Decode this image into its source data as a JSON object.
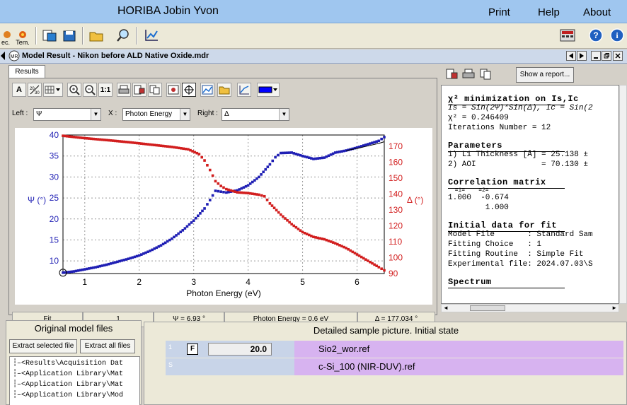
{
  "app": {
    "title": "HORIBA Jobin Yvon",
    "menu": [
      "Print",
      "Help",
      "About"
    ]
  },
  "toolbar": {
    "labels": [
      "ec.",
      "Tem."
    ]
  },
  "window": {
    "title": "Model Result - Nikon before ALD Native Oxide.mdr"
  },
  "tabs": [
    "Results"
  ],
  "plot_toolbar": {
    "text_button": "A",
    "ratio_button": "1:1"
  },
  "axes_select": {
    "left_label": "Left :",
    "left_value": "Ψ",
    "x_label": "X :",
    "x_value": "Photon Energy",
    "right_label": "Right :",
    "right_value": "Δ"
  },
  "chart_data": {
    "type": "line",
    "xlabel": "Photon Energy (eV)",
    "ylabel_left": "Ψ (°)",
    "ylabel_right": "Δ (°)",
    "xlim": [
      0.6,
      6.5
    ],
    "ylim_left": [
      7,
      40
    ],
    "ylim_right": [
      90,
      177
    ],
    "x_ticks": [
      1,
      2,
      3,
      4,
      5,
      6
    ],
    "y_ticks_left": [
      10,
      15,
      20,
      25,
      30,
      35,
      40
    ],
    "y_ticks_right": [
      90,
      100,
      110,
      120,
      130,
      140,
      150,
      160,
      170
    ],
    "series": [
      {
        "axis": "left",
        "color": "#1f1fb4",
        "x": [
          0.6,
          0.8,
          1.0,
          1.2,
          1.4,
          1.6,
          1.8,
          2.0,
          2.2,
          2.4,
          2.6,
          2.8,
          3.0,
          3.2,
          3.3,
          3.4,
          3.5,
          3.6,
          3.8,
          4.0,
          4.2,
          4.4,
          4.5,
          4.6,
          4.8,
          5.0,
          5.2,
          5.4,
          5.6,
          5.8,
          6.0,
          6.2,
          6.4,
          6.5
        ],
        "y": [
          7.2,
          7.5,
          8.0,
          8.5,
          9.1,
          9.8,
          10.5,
          11.3,
          12.4,
          13.7,
          15.3,
          17.3,
          19.6,
          22.5,
          24.5,
          26.7,
          26.5,
          26.3,
          26.8,
          28.0,
          30.0,
          33.0,
          34.7,
          35.7,
          35.8,
          35.0,
          34.3,
          34.6,
          35.8,
          36.3,
          37.0,
          37.8,
          38.6,
          39.5
        ]
      },
      {
        "axis": "right",
        "color": "#d21e1e",
        "x": [
          0.6,
          1.0,
          1.4,
          1.8,
          2.2,
          2.6,
          2.9,
          3.1,
          3.2,
          3.3,
          3.4,
          3.5,
          3.6,
          3.8,
          4.0,
          4.2,
          4.3,
          4.4,
          4.6,
          4.8,
          5.0,
          5.2,
          5.4,
          5.6,
          5.8,
          6.0,
          6.2,
          6.4,
          6.5
        ],
        "y": [
          176.5,
          175.0,
          173.8,
          172.5,
          171.0,
          169.5,
          168.0,
          165.0,
          161.0,
          155.0,
          148.0,
          145.0,
          143.0,
          141.0,
          140.5,
          139.5,
          138.5,
          134.0,
          127.0,
          121.0,
          116.0,
          113.0,
          111.5,
          109.0,
          106.0,
          102.0,
          98.0,
          94.0,
          92.0
        ]
      },
      {
        "axis": "left",
        "color": "#000000",
        "style": "fit",
        "x": [
          5.8,
          6.0,
          6.2,
          6.4,
          6.5
        ],
        "y": [
          36.3,
          36.8,
          37.4,
          38.0,
          38.4
        ]
      }
    ]
  },
  "status_bar": {
    "mode": "Fit",
    "index": "1",
    "psi": "Ψ = 6.93 °",
    "energy": "Photon Energy = 0.6 eV",
    "delta": "Δ = 177.034 °"
  },
  "report": {
    "show_report_button": "Show a report...",
    "lines": [
      {
        "t": "χ² minimization on Is,Ic",
        "h": true
      },
      {
        "t": "Is = Sin(2Ψ)*Sin(Δ), Ic = Sin(2",
        "i": true
      },
      {
        "t": "χ² = 0.246409"
      },
      {
        "t": "Iterations Number = 12"
      },
      {
        "t": ""
      },
      {
        "t": "Parameters",
        "h": true
      },
      {
        "t": "1) L1 Thickness [Å] = 25.138 ±"
      },
      {
        "t": "2) AOI              = 70.130 ±"
      },
      {
        "t": ""
      },
      {
        "t": "Correlation matrix",
        "h": true
      },
      {
        "t": "  =1=    =2=",
        "s": true
      },
      {
        "t": "1.000  -0.674"
      },
      {
        "t": "        1.000"
      },
      {
        "t": ""
      },
      {
        "t": "Initial data for fit",
        "h": true
      },
      {
        "t": "Model File       : Standard Sam"
      },
      {
        "t": "Fitting Choice   : 1"
      },
      {
        "t": "Fitting Routine  : Simple Fit"
      },
      {
        "t": "Experimental file: 2024.07.03\\S"
      },
      {
        "t": ""
      },
      {
        "t": "Spectrum",
        "h": true
      }
    ]
  },
  "model_files": {
    "title": "Original model files",
    "extract_selected": "Extract selected file",
    "extract_all": "Extract all files",
    "tree": [
      "<Results\\Acquisition Dat",
      "<Application Library\\Mat",
      "<Application Library\\Mat",
      "<Application Library\\Mod"
    ]
  },
  "sample": {
    "title": "Detailed sample picture. Initial state",
    "layers": [
      {
        "index": "1",
        "flag": "F",
        "thickness": "20.0",
        "material": "Sio2_wor.ref"
      },
      {
        "index": "S",
        "material": "c-Si_100 (NIR-DUV).ref"
      }
    ]
  }
}
